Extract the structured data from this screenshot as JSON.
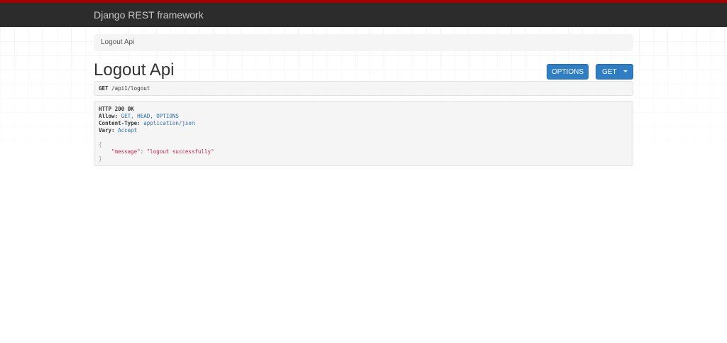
{
  "navbar": {
    "brand": "Django REST framework"
  },
  "breadcrumb": {
    "items": [
      "Logout Api"
    ]
  },
  "page": {
    "title": "Logout Api"
  },
  "buttons": {
    "options_label": "OPTIONS",
    "get_label": "GET"
  },
  "request": {
    "method": "GET",
    "path": "/api1/logout"
  },
  "response": {
    "status": "HTTP 200 OK",
    "headers": [
      {
        "key": "Allow:",
        "value": "GET, HEAD, OPTIONS"
      },
      {
        "key": "Content-Type:",
        "value": "application/json"
      },
      {
        "key": "Vary:",
        "value": "Accept"
      }
    ],
    "body": {
      "open_brace": "{",
      "key": "\"message\"",
      "colon": ": ",
      "value": "\"logout successfully\"",
      "close_brace": "}"
    }
  },
  "colors": {
    "navbar_bg": "#2c2c2c",
    "navbar_accent": "#a30000",
    "button_primary": "#2f7dc2",
    "json_string": "#c7254e",
    "header_value": "#2a6fad"
  }
}
